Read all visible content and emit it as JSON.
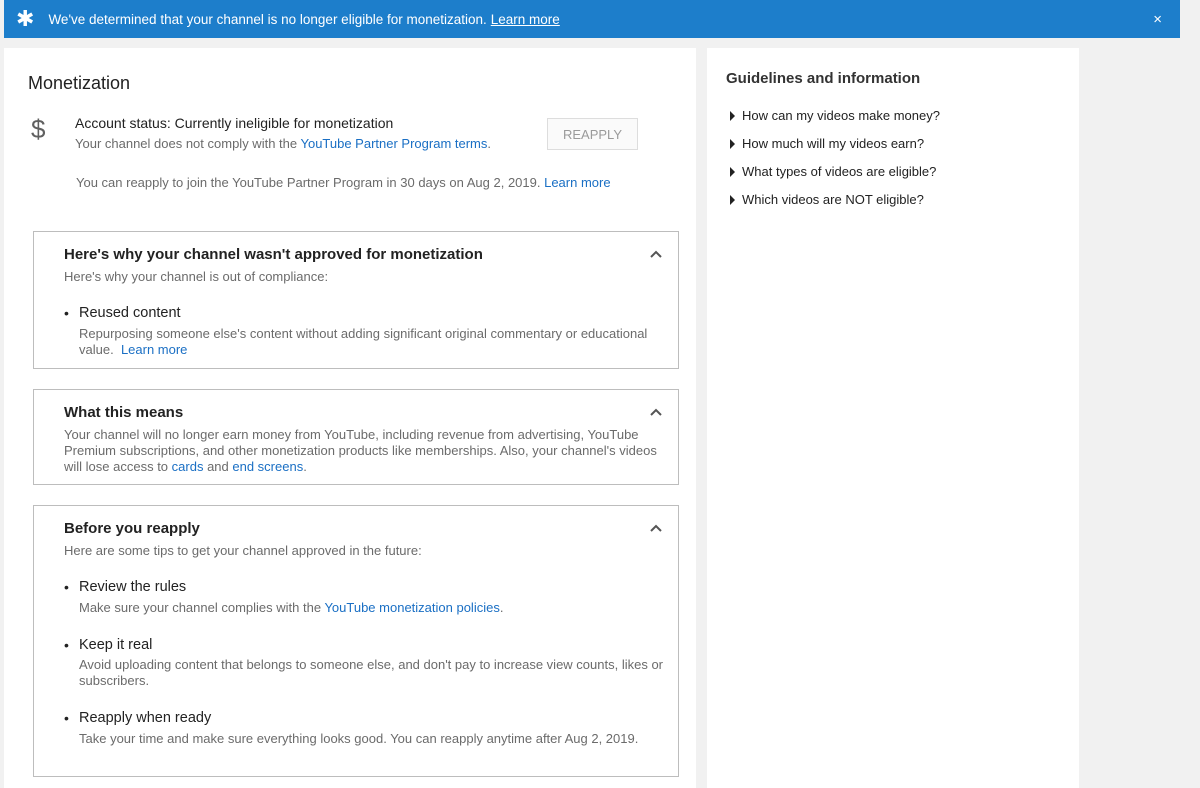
{
  "banner": {
    "message": "We've determined that your channel is no longer eligible for monetization.",
    "link": "Learn more",
    "close": "×"
  },
  "main": {
    "title": "Monetization",
    "account": {
      "status": "Account status: Currently ineligible for monetization",
      "sub_prefix": "Your channel does not comply with the ",
      "sub_link": "YouTube Partner Program terms",
      "sub_suffix": ".",
      "reapply_button": "REAPPLY",
      "note_prefix": "You can reapply to join the YouTube Partner Program in 30 days on Aug 2, 2019. ",
      "note_link": "Learn more"
    },
    "why": {
      "heading": "Here's why your channel wasn't approved for monetization",
      "sub": "Here's why your channel is out of compliance:",
      "item_title": "Reused content",
      "item_text_line1": "Repurposing someone else's content without adding significant original commentary or educational",
      "item_text_line2": "value.",
      "item_link": "Learn more"
    },
    "means": {
      "heading": "What this means",
      "line1": "Your channel will no longer earn money from YouTube, including revenue from advertising, YouTube",
      "line2": "Premium subscriptions, and other monetization products like memberships. Also, your channel's videos",
      "line3_prefix": "will lose access to ",
      "link_cards": "cards",
      "line3_mid": " and ",
      "link_end": "end screens",
      "line3_suffix": "."
    },
    "before": {
      "heading": "Before you reapply",
      "sub": "Here are some tips to get your channel approved in the future:",
      "tips": [
        {
          "title": "Review the rules",
          "text_prefix": "Make sure your channel complies with the ",
          "link": "YouTube monetization policies",
          "text_suffix": "."
        },
        {
          "title": "Keep it real",
          "line1": "Avoid uploading content that belongs to someone else, and don't pay to increase view counts, likes or",
          "line2": "subscribers."
        },
        {
          "title": "Reapply when ready",
          "text": "Take your time and make sure everything looks good. You can reapply anytime after Aug 2, 2019."
        }
      ]
    }
  },
  "side": {
    "title": "Guidelines and information",
    "items": [
      "How can my videos make money?",
      "How much will my videos earn?",
      "What types of videos are eligible?",
      "Which videos are NOT eligible?"
    ]
  },
  "colors": {
    "banner": "#1d7ecb",
    "link": "#1a6fc4"
  },
  "icons": {
    "banner": "star-icon",
    "account": "dollar-icon",
    "collapse": "chevron-up-icon",
    "expand": "triangle-right-icon"
  }
}
